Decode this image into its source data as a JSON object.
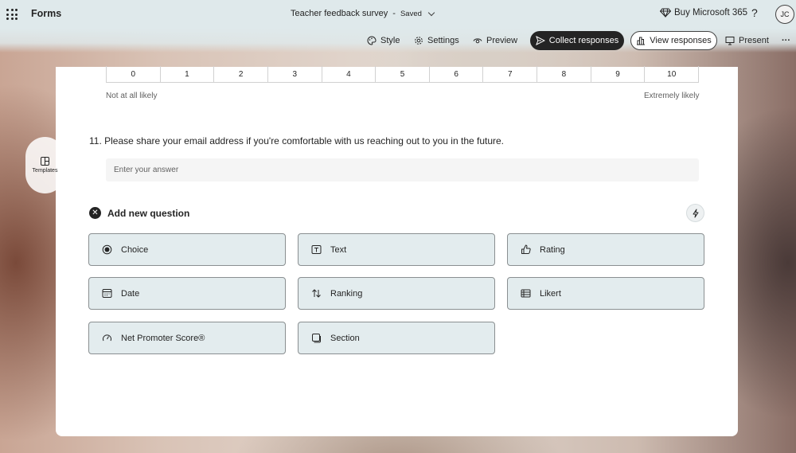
{
  "header": {
    "app_name": "Forms",
    "doc_title": "Teacher feedback survey",
    "separator": "-",
    "save_status": "Saved",
    "buy_label": "Buy Microsoft 365",
    "help_label": "?",
    "avatar_initials": "JC"
  },
  "commands": {
    "style": "Style",
    "settings": "Settings",
    "preview": "Preview",
    "collect": "Collect responses",
    "view": "View responses",
    "present": "Present",
    "more": "···"
  },
  "side": {
    "templates_label": "Templates"
  },
  "scale": {
    "values": [
      "0",
      "1",
      "2",
      "3",
      "4",
      "5",
      "6",
      "7",
      "8",
      "9",
      "10"
    ],
    "low_label": "Not at all likely",
    "high_label": "Extremely likely"
  },
  "question11": {
    "text": "11. Please share your email address if you're comfortable with us reaching out to you in the future.",
    "placeholder": "Enter your answer"
  },
  "add_question": {
    "label": "Add new question",
    "close_glyph": "✕",
    "types": [
      {
        "label": "Choice",
        "icon": "radio-icon"
      },
      {
        "label": "Text",
        "icon": "text-icon"
      },
      {
        "label": "Rating",
        "icon": "thumb-icon"
      },
      {
        "label": "Date",
        "icon": "calendar-icon"
      },
      {
        "label": "Ranking",
        "icon": "ranking-icon"
      },
      {
        "label": "Likert",
        "icon": "likert-icon"
      },
      {
        "label": "Net Promoter Score®",
        "icon": "gauge-icon"
      },
      {
        "label": "Section",
        "icon": "section-icon"
      }
    ]
  },
  "colors": {
    "accent_dark": "#242424",
    "tile_bg": "#e3ecee",
    "header_bg": "#dfe9eb"
  }
}
